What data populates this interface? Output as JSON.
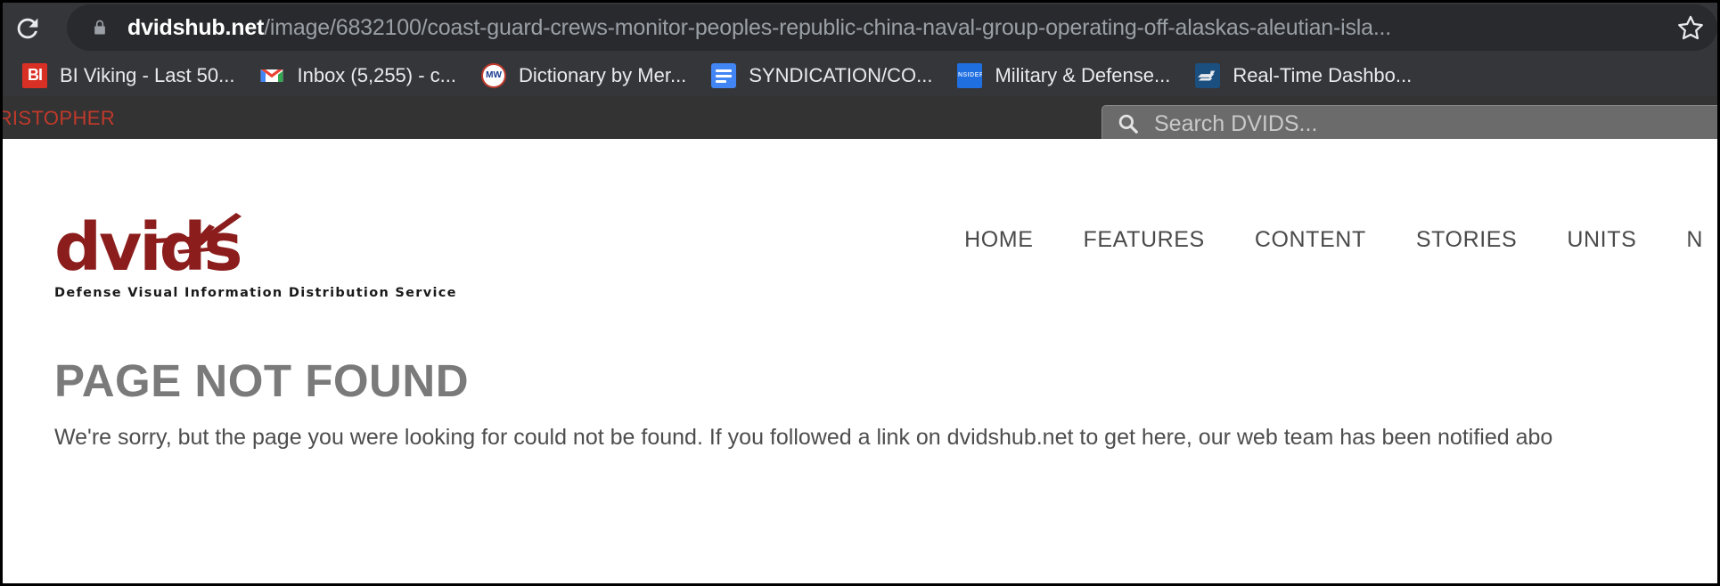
{
  "browser": {
    "reload_tooltip": "Reload",
    "url": {
      "host": "dvidshub.net",
      "path": "/image/6832100/coast-guard-crews-monitor-peoples-republic-china-naval-group-operating-off-alaskas-aleutian-isla...",
      "lock_icon": "lock-icon",
      "star_icon": "bookmark-star-icon"
    },
    "bookmarks": [
      {
        "label": "BI Viking - Last 50...",
        "icon": "bi-favicon",
        "icon_text": "BI"
      },
      {
        "label": "Inbox (5,255) - c...",
        "icon": "gmail-favicon",
        "icon_text": "M"
      },
      {
        "label": "Dictionary by Mer...",
        "icon": "merriam-webster-favicon",
        "icon_text": "MW"
      },
      {
        "label": "SYNDICATION/CO...",
        "icon": "google-docs-favicon",
        "icon_text": ""
      },
      {
        "label": "Military & Defense...",
        "icon": "insider-favicon",
        "icon_text": "INSIDER"
      },
      {
        "label": "Real-Time Dashbo...",
        "icon": "dashboard-favicon",
        "icon_text": ""
      }
    ]
  },
  "site": {
    "topbar": {
      "user_name": "CHRISTOPHER",
      "user_name_color": "#c0392b",
      "search_placeholder": "Search DVIDS...",
      "search_icon": "search-icon",
      "background": "#333333"
    },
    "logo": {
      "wordmark": "dvids",
      "tagline": "Defense Visual Information Distribution Service",
      "color": "#8c1d1d",
      "plane_icon": "airplane-icon"
    },
    "nav": [
      {
        "label": "HOME"
      },
      {
        "label": "FEATURES"
      },
      {
        "label": "CONTENT"
      },
      {
        "label": "STORIES"
      },
      {
        "label": "UNITS"
      },
      {
        "label": "N"
      }
    ],
    "error": {
      "title": "PAGE NOT FOUND",
      "message": "We're sorry, but the page you were looking for could not be found. If you followed a link on dvidshub.net to get here, our web team has been notified abo"
    }
  }
}
